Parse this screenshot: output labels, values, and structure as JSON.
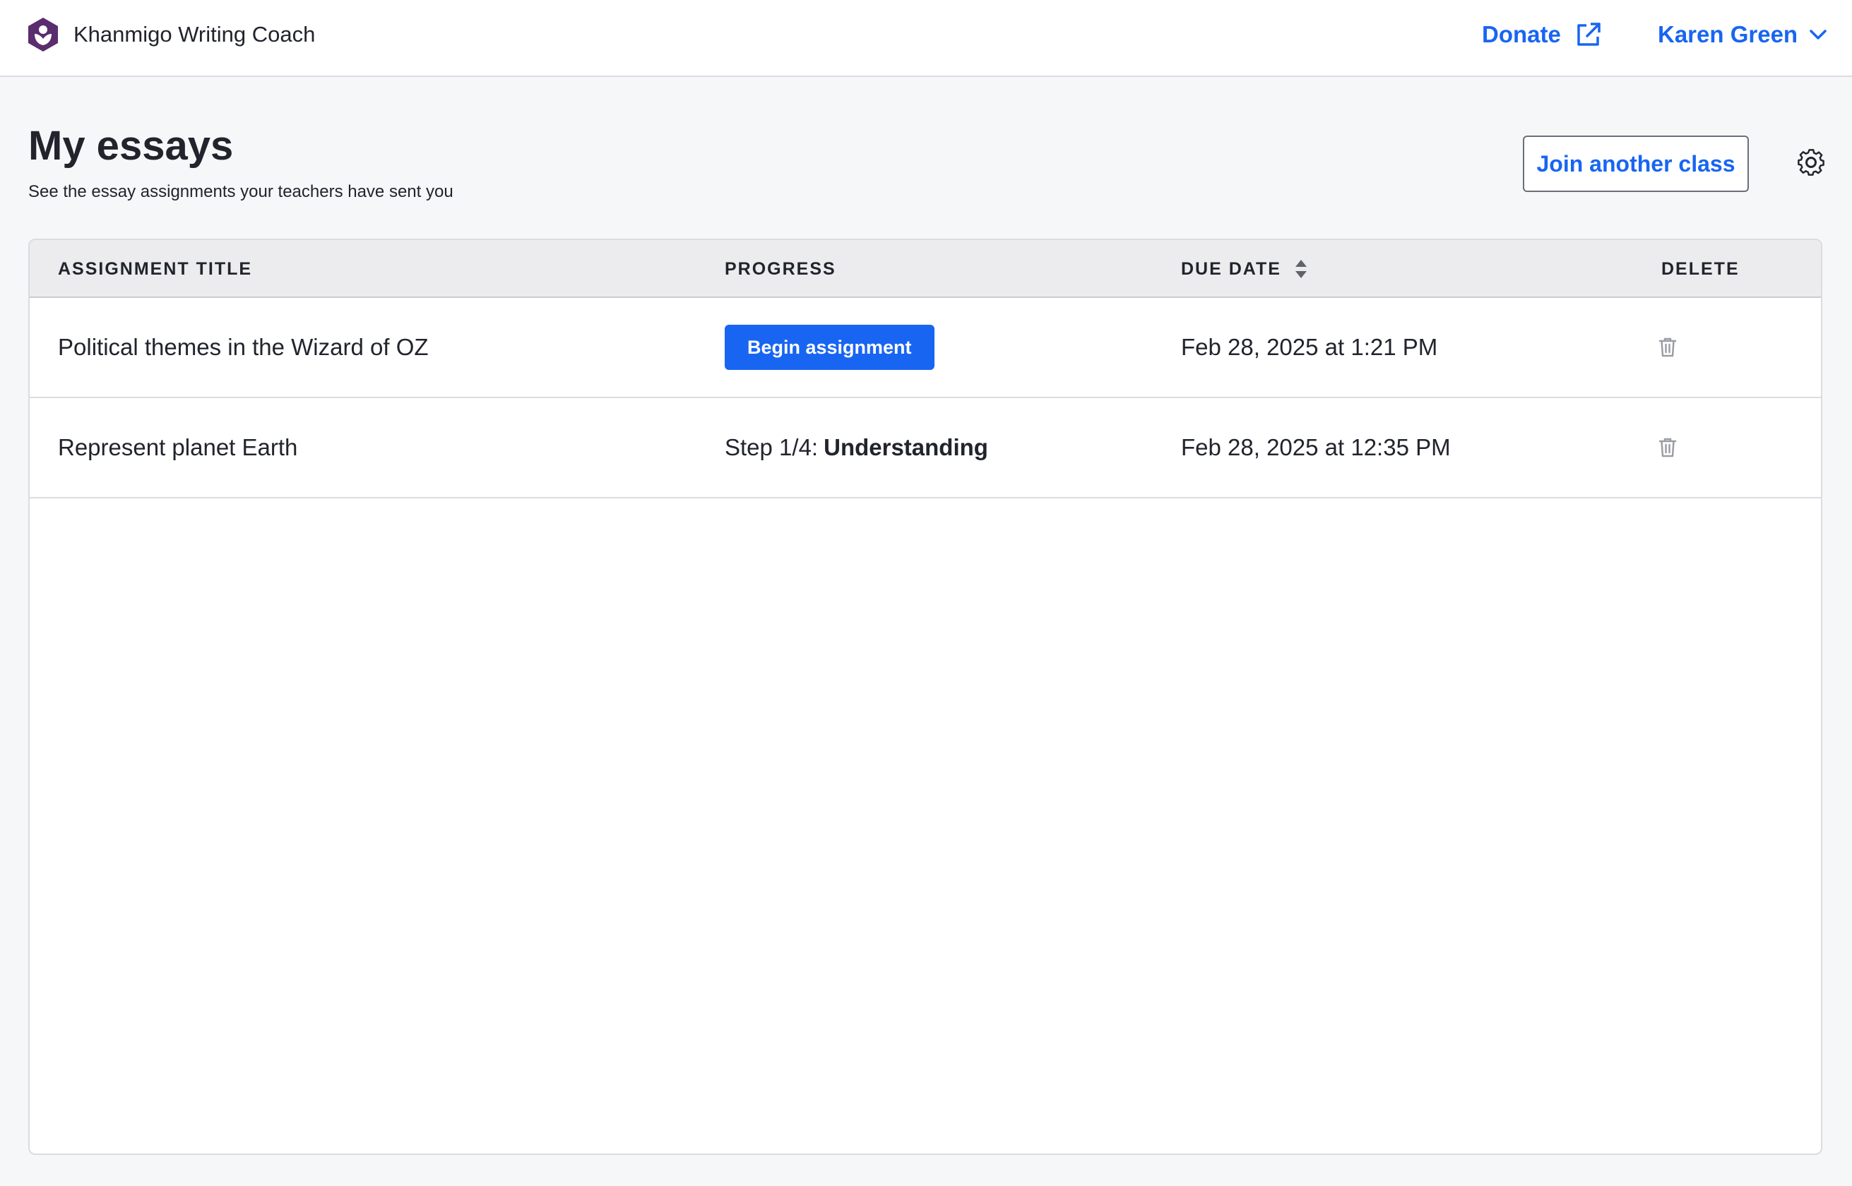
{
  "header": {
    "app_name": "Khanmigo Writing Coach",
    "logo_icon": "khan-hexagon-logo-icon",
    "donate_label": "Donate",
    "donate_icon": "external-link-icon",
    "user_name": "Karen Green",
    "user_menu_icon": "chevron-down-icon"
  },
  "page": {
    "title": "My essays",
    "subtitle": "See the essay assignments your teachers have sent you",
    "join_class_label": "Join another class",
    "settings_icon": "gear-icon"
  },
  "table": {
    "columns": {
      "title": "ASSIGNMENT TITLE",
      "progress": "PROGRESS",
      "due_date": "DUE DATE",
      "delete": "DELETE"
    },
    "sort_icon": "sort-up-down-icon",
    "rows": [
      {
        "title": "Political themes in the Wizard of OZ",
        "progress_button": "Begin assignment",
        "due_date": "Feb 28, 2025 at 1:21 PM",
        "delete_icon": "trash-icon"
      },
      {
        "title": "Represent planet Earth",
        "progress_prefix": "Step 1/4:",
        "progress_step": "Understanding",
        "due_date": "Feb 28, 2025 at 12:35 PM",
        "delete_icon": "trash-icon"
      }
    ]
  },
  "colors": {
    "accent": "#1865f2",
    "brand_purple": "#5a2d6e",
    "background": "#f6f7f8",
    "table_header": "#ececee",
    "text": "#21242c"
  }
}
